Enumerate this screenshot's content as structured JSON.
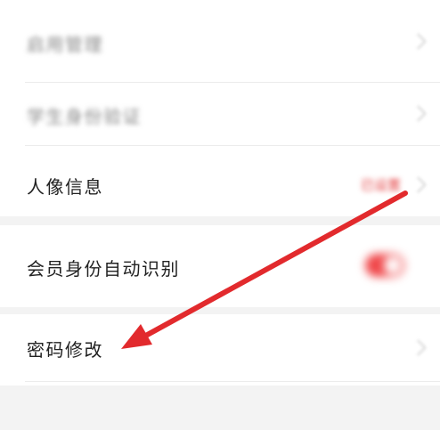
{
  "settings": {
    "items": [
      {
        "label": "启用管理"
      },
      {
        "label": "学生身份验证"
      },
      {
        "label": "人像信息",
        "status": "已设置"
      },
      {
        "label": "会员身份自动识别",
        "toggle_on": true
      },
      {
        "label": "密码修改"
      }
    ]
  },
  "colors": {
    "accent": "#e33a3c",
    "toggle": "#f0474a",
    "arrow": "#e22a2d"
  },
  "annotation": {
    "icon": "red-arrow-pointer",
    "target": "密码修改"
  }
}
